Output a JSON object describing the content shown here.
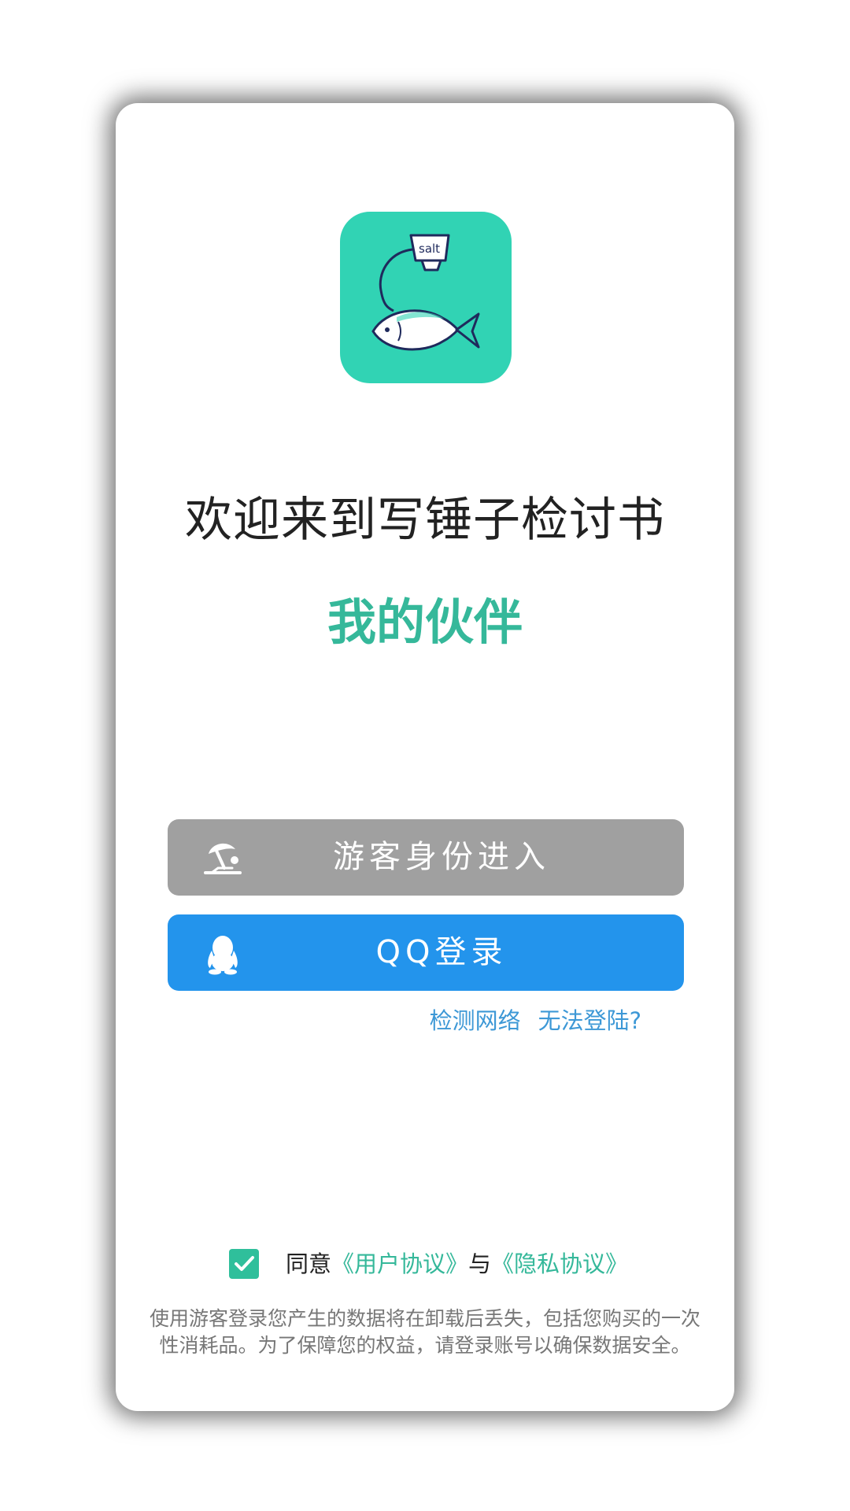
{
  "welcome_title": "欢迎来到写锤子检讨书",
  "slogan": "我的伙伴",
  "logo": {
    "icon": "fish-salt-logo-icon",
    "label_on_jar": "salt",
    "background_color": "#31d3b4"
  },
  "buttons": {
    "guest": {
      "label": "游客身份进入",
      "icon": "beach-umbrella-icon",
      "color": "#a0a0a0"
    },
    "qq": {
      "label": "QQ登录",
      "icon": "qq-penguin-icon",
      "color": "#2394ec"
    }
  },
  "links": {
    "check_network": "检测网络",
    "cannot_login": "无法登陆?"
  },
  "agreement": {
    "checked": true,
    "prefix": "同意",
    "user_agreement": "《用户协议》",
    "connector": "与",
    "privacy_policy": "《隐私协议》"
  },
  "notice": "使用游客登录您产生的数据将在卸载后丢失，包括您购买的一次性消耗品。为了保障您的权益，请登录账号以确保数据安全。",
  "colors": {
    "accent_green": "#35b89a",
    "link_blue": "#3d98d6"
  }
}
